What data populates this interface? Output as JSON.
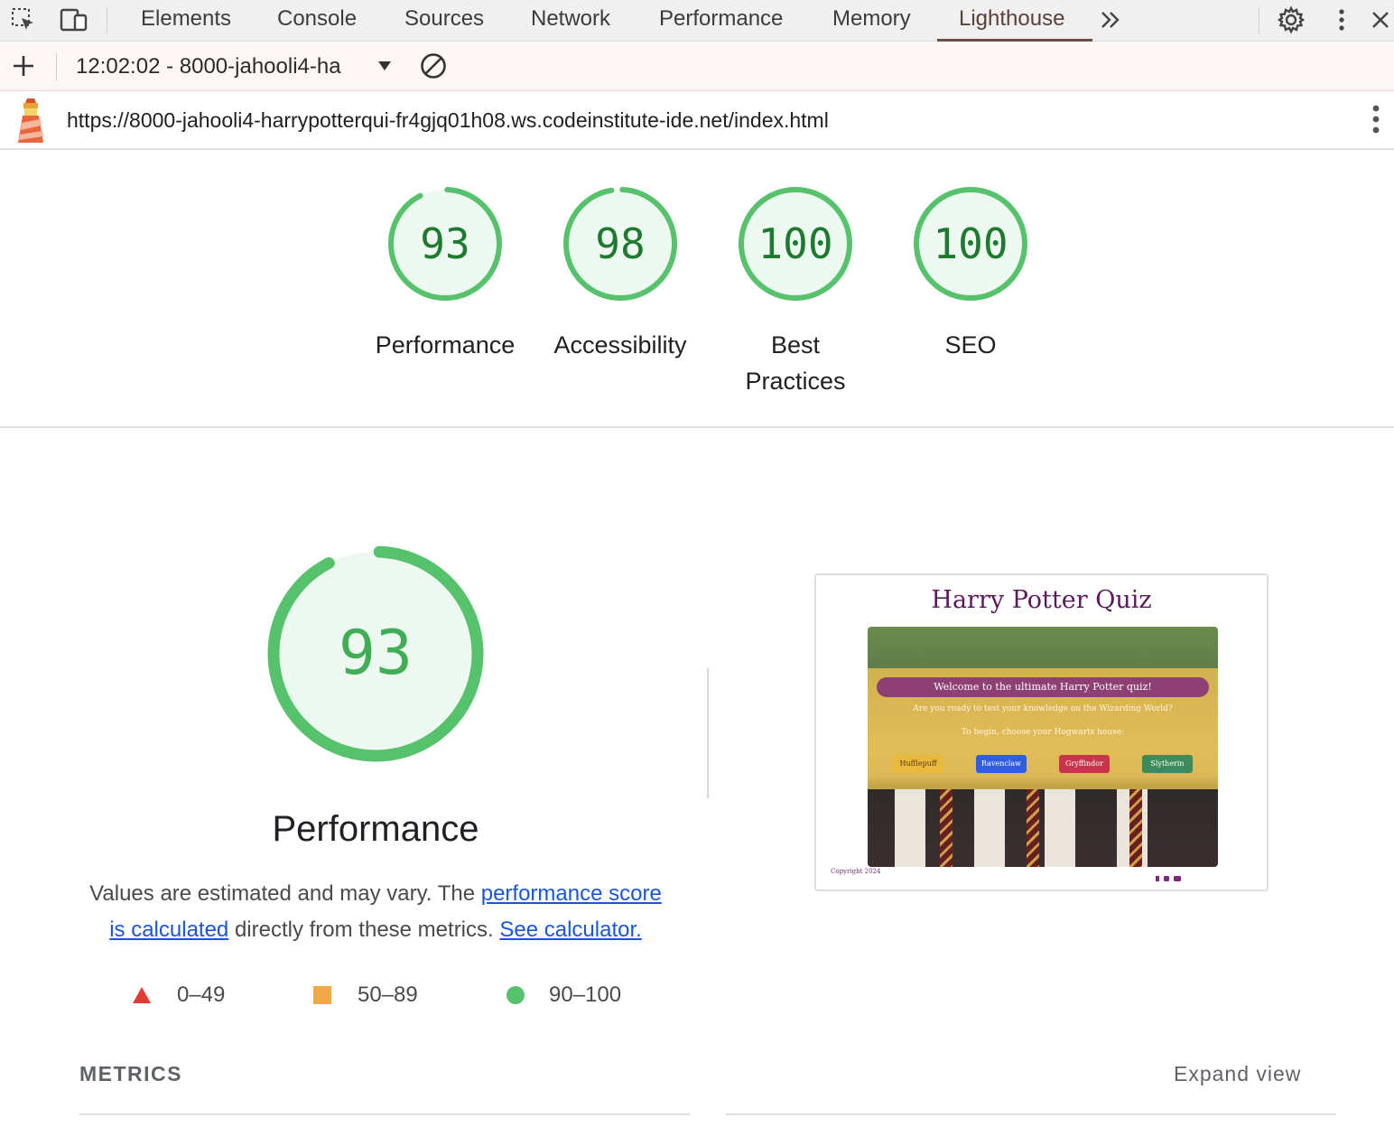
{
  "devtools": {
    "tabs": [
      "Elements",
      "Console",
      "Sources",
      "Network",
      "Performance",
      "Memory",
      "Lighthouse"
    ],
    "active_tab": "Lighthouse"
  },
  "toolbar": {
    "report_label": "12:02:02 - 8000-jahooli4-ha"
  },
  "urlbar": {
    "url": "https://8000-jahooli4-harrypotterqui-fr4gjq01h08.ws.codeinstitute-ide.net/index.html"
  },
  "scores": [
    {
      "label": "Performance",
      "score": "93",
      "value": 93
    },
    {
      "label": "Accessibility",
      "score": "98",
      "value": 98
    },
    {
      "label": "Best Practices",
      "score": "100",
      "value": 100
    },
    {
      "label": "SEO",
      "score": "100",
      "value": 100
    }
  ],
  "performance": {
    "score": "93",
    "value": 93,
    "title": "Performance",
    "desc_1": "Values are estimated and may vary. The ",
    "link_1": "performance score is calculated",
    "desc_2": " directly from these metrics. ",
    "link_2": "See calculator."
  },
  "legend": [
    {
      "range": "0–49",
      "shape": "triangle",
      "color": "#e53935"
    },
    {
      "range": "50–89",
      "shape": "square",
      "color": "#f2a945"
    },
    {
      "range": "90–100",
      "shape": "circle",
      "color": "#57c26c"
    }
  ],
  "thumbnail": {
    "title": "Harry Potter Quiz",
    "welcome": "Welcome to the ultimate Harry Potter quiz!",
    "line_1": "Are you ready to test your knowledge on the Wizarding World?",
    "line_2": "To begin, choose your Hogwarts house:",
    "houses": [
      {
        "name": "Hufflepuff",
        "color": "#e8b93a"
      },
      {
        "name": "Ravenclaw",
        "color": "#2f5ee0"
      },
      {
        "name": "Gryffindor",
        "color": "#c8344a"
      },
      {
        "name": "Slytherin",
        "color": "#3d8a5a"
      }
    ],
    "copyright": "Copyright 2024"
  },
  "metrics": {
    "title": "METRICS",
    "expand": "Expand view"
  },
  "colors": {
    "pass": "#57c26c",
    "pass_fill": "#edf8f0",
    "pass_text": "#1e7a2e",
    "accent": "#6d4c41"
  }
}
